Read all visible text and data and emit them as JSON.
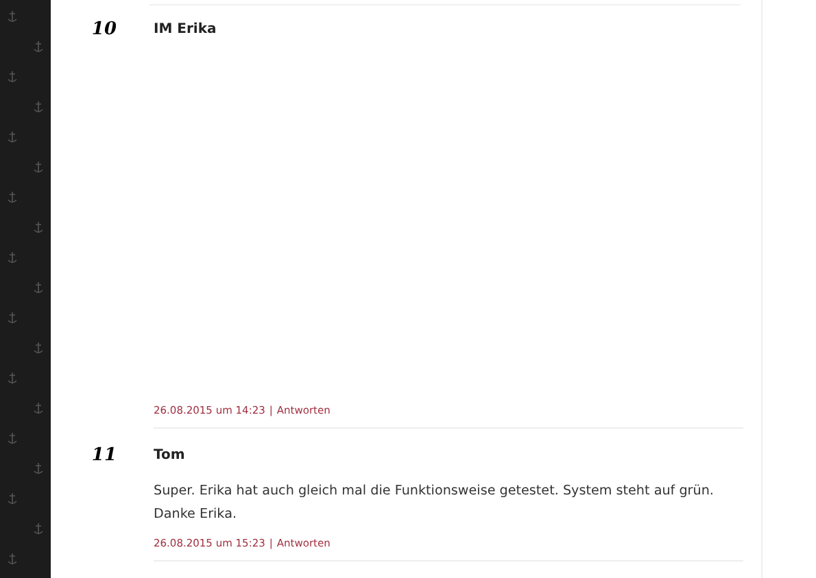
{
  "comments": [
    {
      "number": "10",
      "author": "IM Erika",
      "date": "26.08.2015 um 14:23",
      "separator": "|",
      "reply": "Antworten",
      "kind": "media"
    },
    {
      "number": "11",
      "author": "Tom",
      "text": "Super. Erika hat auch gleich mal die Funktionsweise getestet. System steht auf grün. Danke Erika.",
      "date": "26.08.2015 um 15:23",
      "separator": "|",
      "reply": "Antworten",
      "kind": "text"
    }
  ]
}
